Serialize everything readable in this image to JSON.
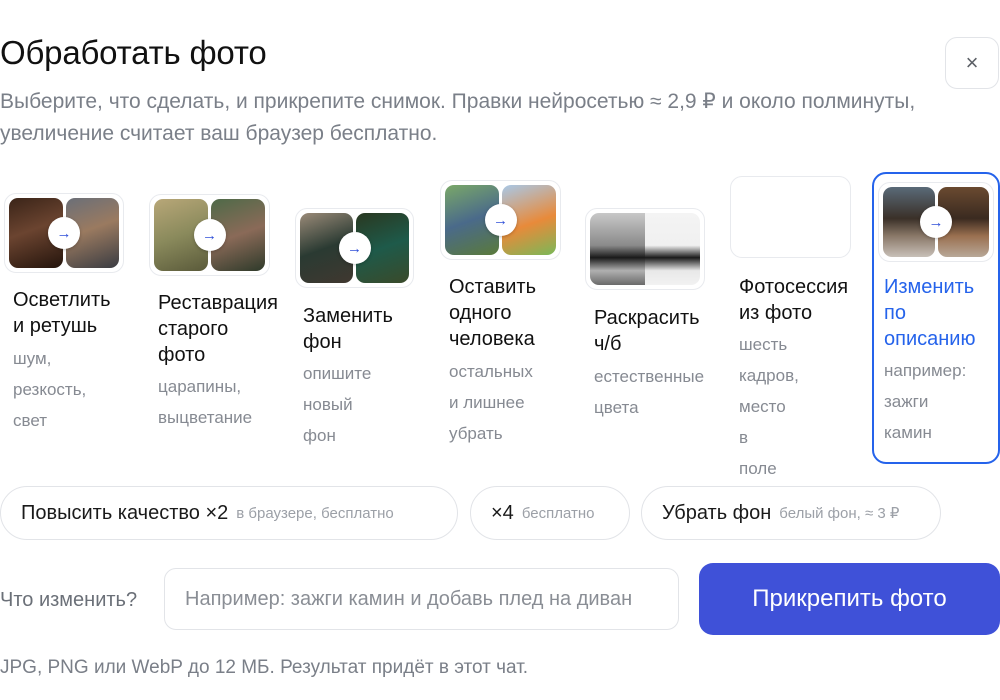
{
  "header": {
    "title": "Обработать фото",
    "subtitle": "Выберите, что сделать, и прикрепите снимок. Правки нейросетью ≈ 2,9 ₽ и около полминуты, увеличение считает ваш браузер бесплатно.",
    "close_label": "×"
  },
  "cards": [
    {
      "label": "Осветлить\nи ретушь",
      "desc": "шум,\nрезкость,\nсвет",
      "icon": "brighten-retouch-preview"
    },
    {
      "label": "Реставрация\nстарого\nфото",
      "desc": "царапины,\nвыцветание",
      "icon": "restore-old-photo-preview"
    },
    {
      "label": "Заменить\nфон",
      "desc": "опишите\nновый фон",
      "icon": "replace-background-preview"
    },
    {
      "label": "Оставить\nодного\nчеловека",
      "desc": "остальных\nи лишнее\nубрать",
      "icon": "keep-one-person-preview"
    },
    {
      "label": "Раскрасить\nч/б",
      "desc": "естественные\nцвета",
      "icon": "colorize-preview"
    },
    {
      "label": "Фотосессия\nиз фото",
      "desc": "шесть\nкадров,\nместо в\nполе",
      "icon": "photoshoot-preview"
    },
    {
      "label": "Изменить\nпо\nописанию",
      "desc": "например:\nзажги\nкамин",
      "icon": "edit-by-description-preview",
      "selected": true
    }
  ],
  "arrow_glyph": "→",
  "chips": [
    {
      "main": "Повысить качество ×2",
      "sub": "в браузере, бесплатно"
    },
    {
      "main": "×4",
      "sub": "бесплатно"
    },
    {
      "main": "Убрать фон",
      "sub": "белый фон, ≈ 3 ₽"
    }
  ],
  "prompt": {
    "label": "Что изменить?",
    "placeholder": "Например: зажги камин и добавь плед на диван",
    "value": ""
  },
  "attach_label": "Прикрепить фото",
  "footer": "JPG, PNG или WebP до 12 МБ. Результат придёт в этот чат.",
  "colors": {
    "accent": "#2563eb",
    "button": "#3f51d8",
    "muted": "#7a7f88"
  }
}
